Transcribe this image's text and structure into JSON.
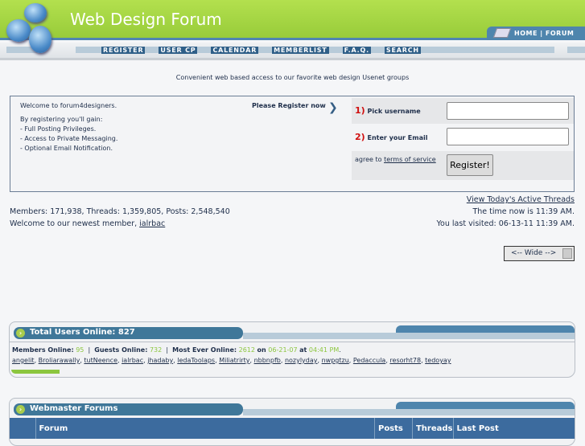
{
  "header": {
    "title": "Web Design Forum",
    "home_link": "HOME | FORUM"
  },
  "nav": [
    "REGISTER",
    "USER CP",
    "CALENDAR",
    "MEMBERLIST",
    "F.A.Q.",
    "SEARCH"
  ],
  "tagline": "Convenient web based access to our favorite web design Usenet groups",
  "register": {
    "welcome": "Welcome to forum4designers.",
    "gain": "By registering you'll gain:",
    "benefits": [
      "- Full Posting Privileges.",
      "- Access to Private Messaging.",
      "- Optional Email Notification."
    ],
    "please": "Please Register now",
    "step1_num": "1)",
    "step1": "Pick username",
    "step2_num": "2)",
    "step2": "Enter your Email",
    "agree": "agree to",
    "terms": "terms of service",
    "button": "Register!"
  },
  "stats": {
    "active_threads": "View Today's Active Threads",
    "counts": "Members: 171,938, Threads: 1,359,805, Posts: 2,548,540",
    "time_now": "The time now is 11:39 AM.",
    "newest_prefix": "Welcome to our newest member,",
    "newest": "ialrbac",
    "last_visited": "You last visited: 06-13-11 11:39 AM."
  },
  "wide_select": "<-- Wide -->",
  "online": {
    "title": "Total Users Online: 827",
    "members_label": "Members Online:",
    "members": "95",
    "guests_label": "Guests Online:",
    "guests": "732",
    "most_label": "Most Ever Online:",
    "most": "2612",
    "on": "on",
    "date": "06-21-07",
    "at": "at",
    "time": "04:41 PM",
    "users": [
      "angelit",
      "Broliarawally",
      "tutNeence",
      "ialrbac",
      "jhadaby",
      "ledaToolaps",
      "Miliatrirty",
      "nbbnpfb",
      "nozylyday",
      "nwpgtzu",
      "Pedaccula",
      "resorht78",
      "tedoyay"
    ]
  },
  "forums": {
    "title": "Webmaster Forums",
    "columns": [
      "Forum",
      "Posts",
      "Threads",
      "Last Post"
    ]
  }
}
